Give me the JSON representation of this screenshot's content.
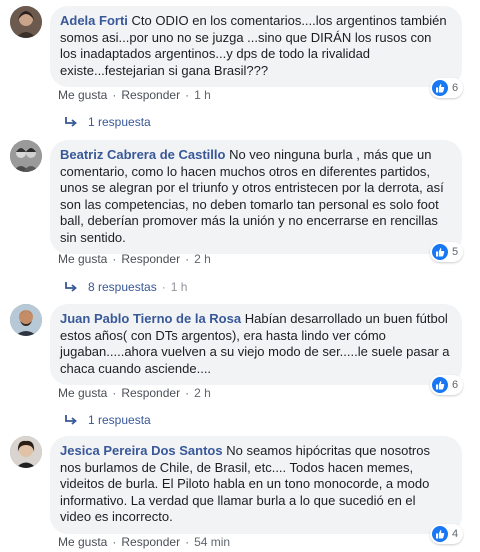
{
  "like_label": "Me gusta",
  "reply_label": "Responder",
  "separator": "·",
  "comments": [
    {
      "author": "Adela Forti",
      "text": "Cto ODIO en los comentarios....los argentinos también somos asi...por uno no se juzga ...sino que DIRÁN los rusos con los inadaptados argentinos...y dps de todo la rivalidad existe...festejarian si gana Brasil???",
      "time": "1 h",
      "reactions": "6",
      "replies": "1 respuesta",
      "replies_time": ""
    },
    {
      "author": "Beatriz Cabrera de Castillo",
      "text": "No veo ninguna burla , más que un comentario, como lo hacen muchos otros en diferentes partidos, unos se alegran por el triunfo y otros entristecen por la derrota, así son las competencias, no deben tomarlo tan personal es solo foot ball, deberían promover más la unión y no encerrarse en rencillas sin sentido.",
      "time": "2 h",
      "reactions": "5",
      "replies": "8 respuestas",
      "replies_time": "1 h"
    },
    {
      "author": "Juan Pablo Tierno de la Rosa",
      "text": "Habían desarrollado un buen fútbol estos años( con DTs argentos), era hasta lindo ver cómo jugaban.....ahora vuelven a su viejo modo de ser.....le suele pasar a chaca cuando asciende....",
      "time": "2 h",
      "reactions": "6",
      "replies": "1 respuesta",
      "replies_time": ""
    },
    {
      "author": "Jesica Pereira Dos Santos",
      "text": "No seamos hipócritas que nosotros nos burlamos de Chile, de Brasil, etc.... Todos hacen memes, videitos de burla. El Piloto habla en un tono monocorde, a modo informativo. La verdad que llamar burla a lo que sucedió en el video es incorrecto.",
      "time": "54 min",
      "reactions": "4",
      "replies": "",
      "replies_time": ""
    }
  ]
}
